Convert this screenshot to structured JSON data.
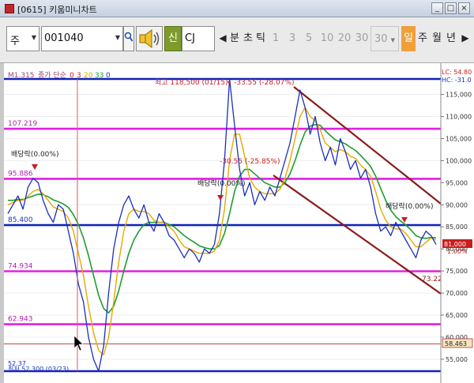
{
  "window": {
    "title": "[0615] 키움미니차트",
    "buttons": [
      "_",
      "□",
      "×"
    ]
  },
  "toolbar": {
    "market_select": "주",
    "code_value": "001040",
    "signal_label": "신",
    "stock_name": "CJ",
    "type_labels": [
      "분",
      "초",
      "틱"
    ],
    "intervals": [
      "1",
      "3",
      "5",
      "10",
      "20",
      "30",
      "30"
    ],
    "period_labels": [
      "일",
      "주",
      "월",
      "년"
    ],
    "nav_prev": "◀",
    "nav_next": "▶"
  },
  "colors": {
    "price_line": "#1a2fbf",
    "ma_fast": "#e6a800",
    "ma_mid": "#1e9d2e",
    "ma_slow": "#c81e1e",
    "fib_level": "#e020e0",
    "support_level": "#1023b8",
    "channel": "#8b1a1a",
    "current_level": "#a83232",
    "annotation": "#c81e1e"
  },
  "legend": {
    "top_code": "M1.315",
    "text": "종가 단순",
    "ma_periods": [
      "0",
      "3",
      "20",
      "33",
      "0"
    ]
  },
  "annotations": {
    "high": "최고 118,500 (01/15)",
    "high_change": "-33.55 (-28.07%)",
    "dividend_left": "배당락(0.00%)",
    "dividend_mid": "배당락(0.00%)",
    "mid_change": "-30.55 (-25.85%)",
    "dividend_right": "배당락(0.00%)",
    "low": "최저 52,300 (03/23)",
    "low_code": "52.37",
    "channel_label": "73.22"
  },
  "axis_top": {
    "lc": "LC: 54.80",
    "hc": "HC: -31.0"
  },
  "chart_data": {
    "type": "line",
    "title": "",
    "ylabel": "",
    "ylim": [
      50000,
      120000
    ],
    "y_ticks": [
      "115,000",
      "110,000",
      "105,000",
      "100,000",
      "95,000",
      "90,000",
      "85,000",
      "80,000",
      "75,000",
      "70,000",
      "65,000",
      "60,000",
      "55,000"
    ],
    "horizontal_levels": [
      {
        "label": "107.219",
        "value": 107219,
        "kind": "fib"
      },
      {
        "label": "95.886",
        "value": 95886,
        "kind": "fib"
      },
      {
        "label": "85.400",
        "value": 85400,
        "kind": "support"
      },
      {
        "label": "74.934",
        "value": 74934,
        "kind": "fib"
      },
      {
        "label": "62.943",
        "value": 62943,
        "kind": "fib"
      }
    ],
    "top_line_value": 118500,
    "bottom_line_value": 52300,
    "current_price": "81,000",
    "current_change": "1.00%",
    "current_level_label": "58.463",
    "current_level_value": 58463,
    "price": [
      88000,
      90000,
      92000,
      89000,
      94000,
      96000,
      95000,
      91000,
      88000,
      86000,
      90000,
      89000,
      84000,
      79000,
      72000,
      68000,
      60000,
      55000,
      52300,
      58000,
      70000,
      80000,
      86000,
      90000,
      92000,
      89000,
      87000,
      90000,
      86000,
      84000,
      88000,
      86000,
      83000,
      82000,
      80000,
      78000,
      80000,
      79000,
      77000,
      80000,
      79000,
      81000,
      88000,
      100000,
      118500,
      108000,
      98000,
      92000,
      95000,
      90000,
      93000,
      91000,
      94000,
      92000,
      96000,
      100000,
      104000,
      110000,
      116000,
      112000,
      106000,
      110000,
      104000,
      100000,
      103000,
      99000,
      105000,
      102000,
      98000,
      100000,
      96000,
      98000,
      94000,
      88000,
      84000,
      85000,
      83000,
      86000,
      84000,
      82000,
      80000,
      78000,
      82000,
      84000,
      83000,
      81000
    ],
    "ma_fast": [
      90000,
      90500,
      91000,
      91000,
      92000,
      93000,
      93500,
      92500,
      91000,
      89500,
      89000,
      88500,
      87000,
      84000,
      79000,
      74000,
      67000,
      61000,
      57000,
      56000,
      60000,
      68000,
      77000,
      84000,
      88000,
      89000,
      88500,
      88500,
      88000,
      86500,
      86000,
      86000,
      85000,
      84000,
      82000,
      80500,
      80000,
      79500,
      79000,
      79000,
      79000,
      79500,
      82000,
      89000,
      100000,
      106000,
      106000,
      101000,
      96000,
      94000,
      93000,
      92500,
      92500,
      92500,
      93500,
      96000,
      100000,
      105000,
      110000,
      112000,
      110000,
      109000,
      107000,
      104000,
      103000,
      102000,
      102500,
      102000,
      101000,
      100500,
      99000,
      98000,
      96500,
      93000,
      89000,
      86500,
      85000,
      84500,
      84500,
      83500,
      82000,
      80500,
      80500,
      81500,
      82500,
      82000
    ],
    "ma_mid": [
      91000,
      91000,
      91200,
      91200,
      91600,
      92000,
      92400,
      92300,
      91800,
      91100,
      90700,
      90200,
      89400,
      87800,
      85500,
      82500,
      78500,
      74000,
      69500,
      66500,
      65500,
      67000,
      70500,
      75000,
      79000,
      82000,
      84000,
      85500,
      86000,
      86000,
      86000,
      86000,
      85500,
      85000,
      84000,
      83000,
      82200,
      81500,
      80700,
      80300,
      80000,
      80000,
      80800,
      83500,
      88000,
      93000,
      96500,
      98000,
      98000,
      97000,
      96000,
      95000,
      94500,
      94000,
      94000,
      95000,
      97000,
      100000,
      103500,
      106500,
      107800,
      108200,
      108000,
      106800,
      105700,
      104700,
      104300,
      103800,
      103000,
      102300,
      101200,
      100000,
      98700,
      96500,
      93700,
      91000,
      88800,
      87300,
      86300,
      85400,
      84300,
      83000,
      82500,
      82400,
      82600,
      82500
    ]
  }
}
